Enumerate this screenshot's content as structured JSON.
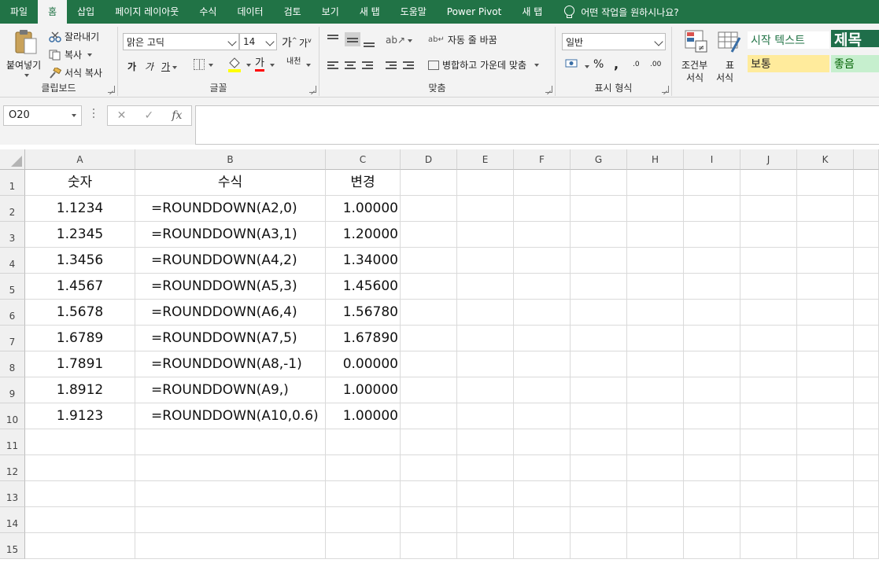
{
  "menu": {
    "tabs": [
      "파일",
      "홈",
      "삽입",
      "페이지 레이아웃",
      "수식",
      "데이터",
      "검토",
      "보기",
      "새 탭",
      "도움말",
      "Power Pivot",
      "새 탭"
    ],
    "active_index": 1,
    "tell_me": "어떤 작업을 원하시나요?"
  },
  "ribbon": {
    "clipboard": {
      "paste": "붙여넣기",
      "cut": "잘라내기",
      "copy": "복사",
      "format_painter": "서식 복사",
      "label": "클립보드"
    },
    "font": {
      "name": "맑은 고딕",
      "size": "14",
      "grow": "가",
      "shrink": "가",
      "bold": "가",
      "italic": "가",
      "underline": "가",
      "font_color": "가",
      "phonetic": "내천",
      "label": "글꼴"
    },
    "alignment": {
      "wrap": "자동 줄 바꿈",
      "merge": "병합하고 가운데 맞춤",
      "label": "맞춤"
    },
    "number": {
      "format": "일반",
      "percent": "%",
      "comma": ",",
      "inc_decimal": ".0",
      "dec_decimal": ".00",
      "label": "표시 형식"
    },
    "styles": {
      "conditional_1": "조건부",
      "conditional_2": "서식",
      "table_1": "표",
      "table_2": "서식",
      "style_start": "시작 텍스트",
      "style_title": "제목",
      "style_normal": "보통",
      "style_good": "좋음"
    }
  },
  "formula_bar": {
    "name_box": "O20",
    "cancel": "✕",
    "enter": "✓",
    "fx": "fx",
    "content": ""
  },
  "columns": [
    "A",
    "B",
    "C",
    "D",
    "E",
    "F",
    "G",
    "H",
    "I",
    "J",
    "K"
  ],
  "rows": [
    "1",
    "2",
    "3",
    "4",
    "5",
    "6",
    "7",
    "8",
    "9",
    "10",
    "11",
    "12",
    "13",
    "14",
    "15"
  ],
  "sheet": {
    "header": [
      "숫자",
      "수식",
      "변경"
    ],
    "data": [
      [
        "1.1234",
        "=ROUNDDOWN(A2,0)",
        "1.00000"
      ],
      [
        "1.2345",
        "=ROUNDDOWN(A3,1)",
        "1.20000"
      ],
      [
        "1.3456",
        "=ROUNDDOWN(A4,2)",
        "1.34000"
      ],
      [
        "1.4567",
        "=ROUNDDOWN(A5,3)",
        "1.45600"
      ],
      [
        "1.5678",
        "=ROUNDDOWN(A6,4)",
        "1.56780"
      ],
      [
        "1.6789",
        "=ROUNDDOWN(A7,5)",
        "1.67890"
      ],
      [
        "1.7891",
        "=ROUNDDOWN(A8,-1)",
        "0.00000"
      ],
      [
        "1.8912",
        "=ROUNDDOWN(A9,)",
        "1.00000"
      ],
      [
        "1.9123",
        "=ROUNDDOWN(A10,0.6)",
        "1.00000"
      ]
    ]
  },
  "colors": {
    "accent": "#217346",
    "style_normal_bg": "#ffeb9c",
    "style_good_bg": "#c6efce",
    "style_good_fg": "#006100",
    "style_title_fg": "#1f4e3d"
  }
}
